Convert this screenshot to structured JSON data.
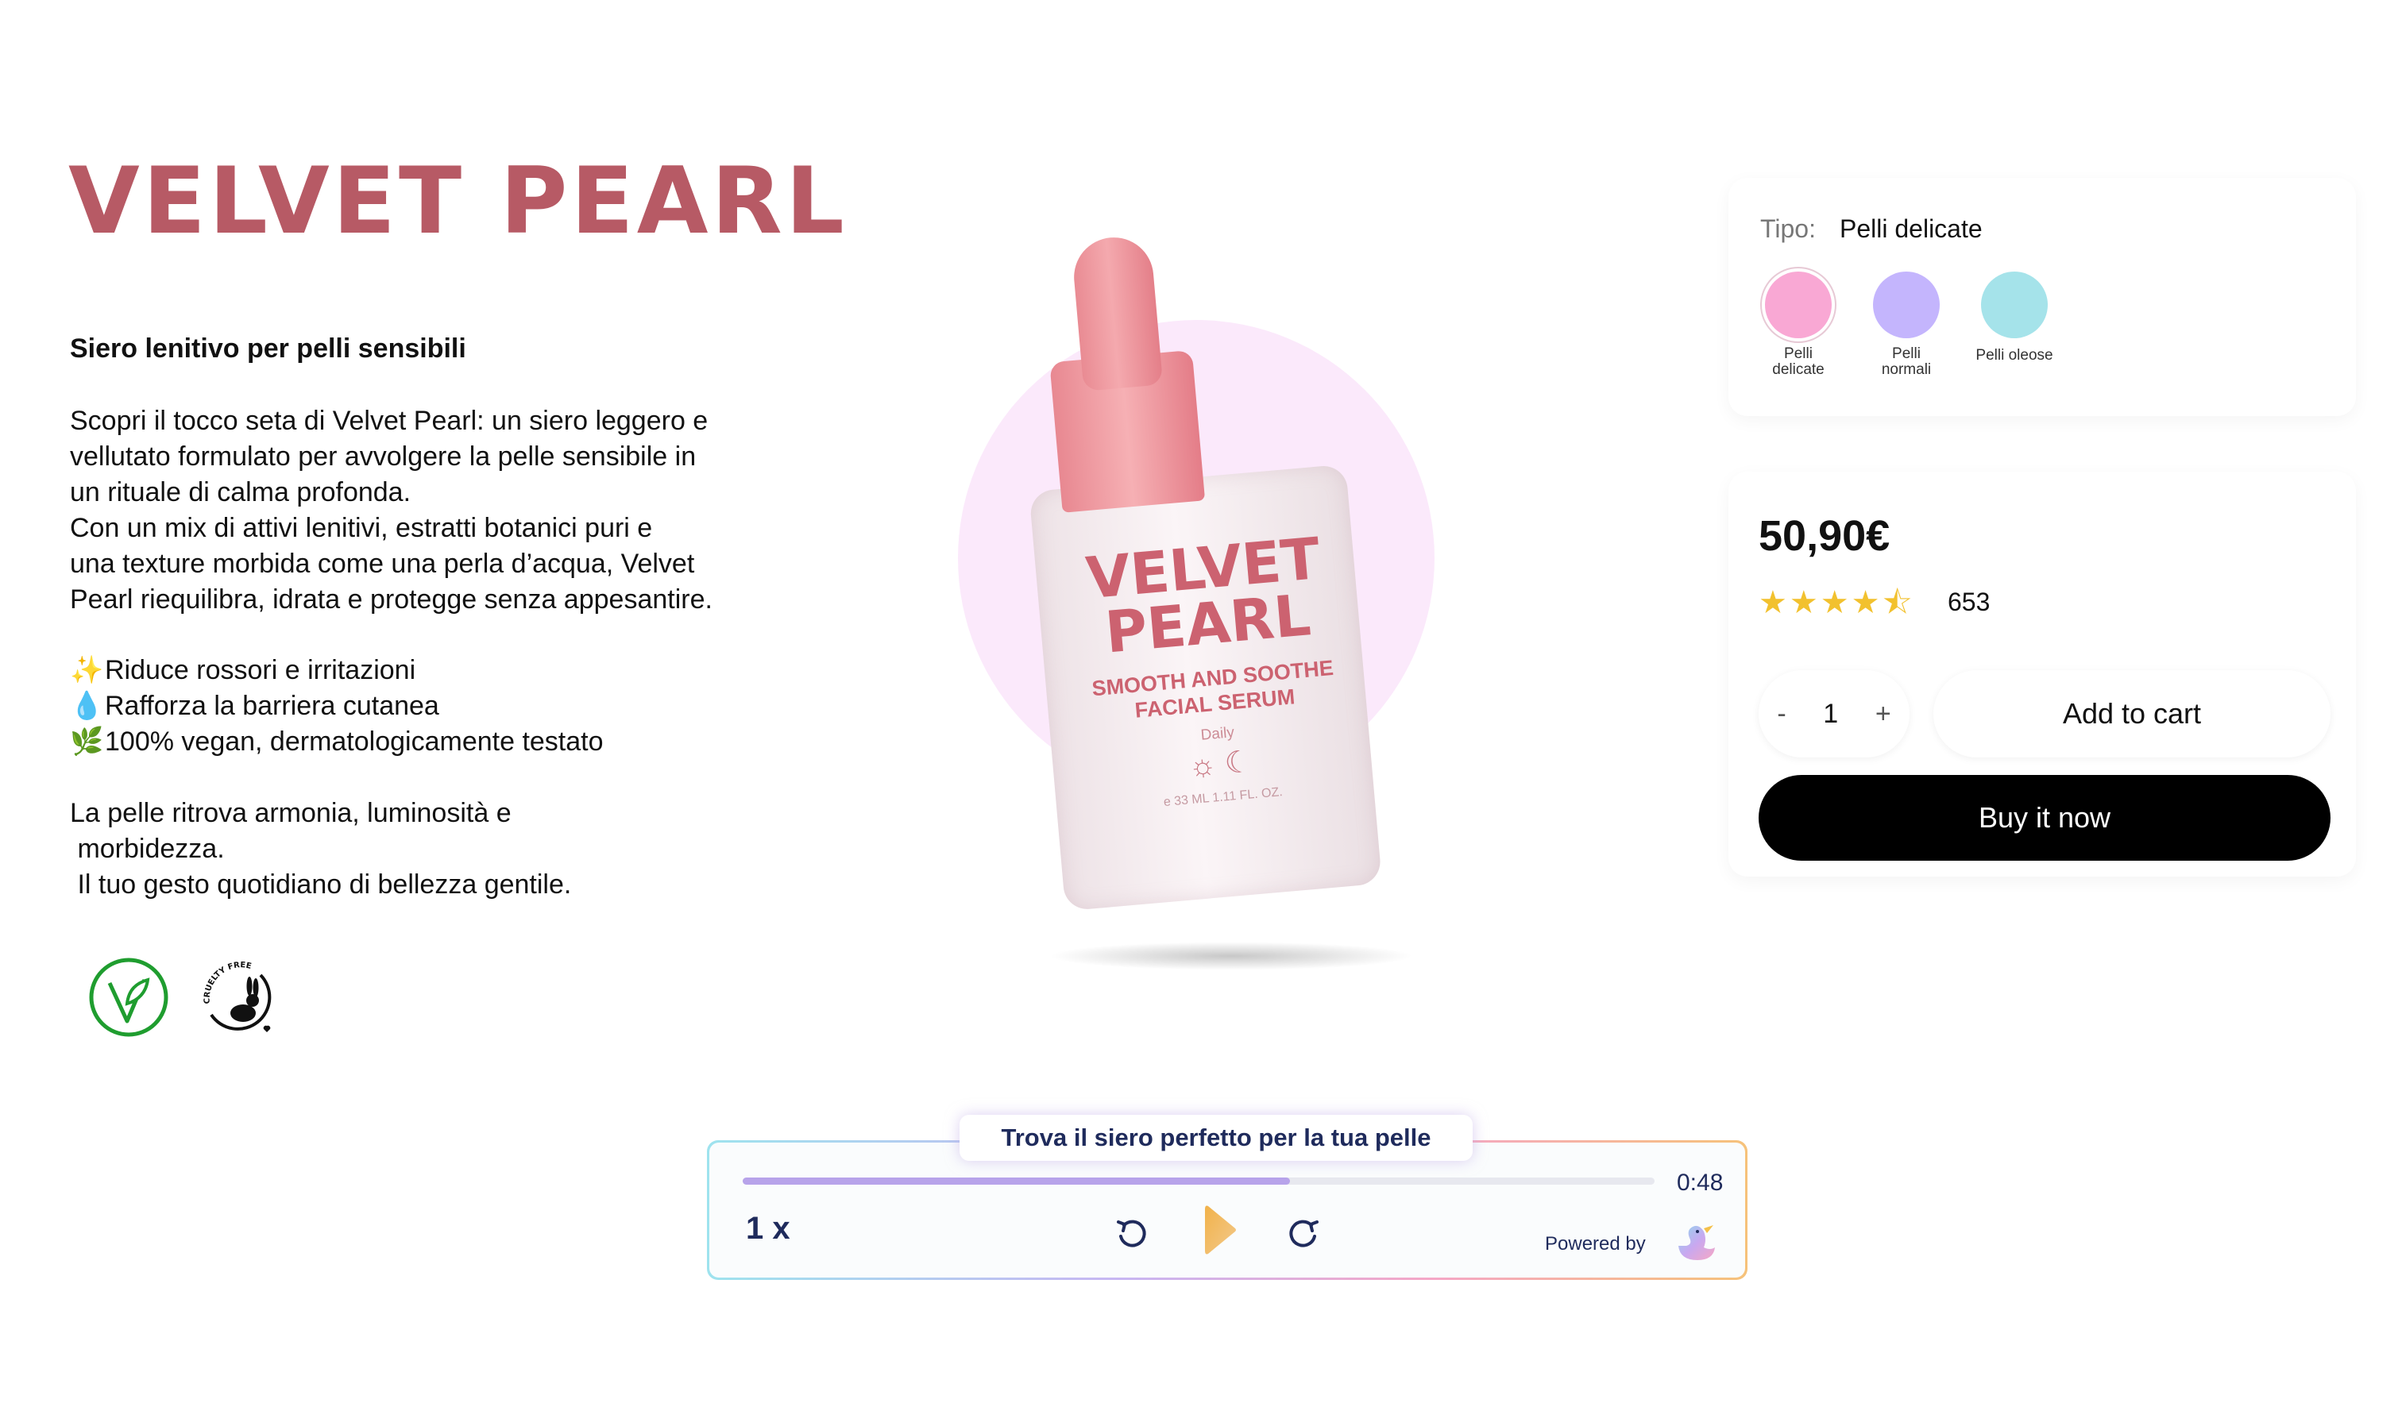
{
  "product": {
    "title": "VELVET PEARL",
    "subtitle": "Siero lenitivo per pelli sensibili",
    "intro": [
      "Scopri il tocco seta di Velvet Pearl: un siero leggero e",
      "vellutato formulato per avvolgere la pelle sensibile in",
      "un rituale di calma profonda.",
      "Con un mix di attivi lenitivi, estratti botanici puri e",
      "una texture morbida come una perla d’acqua, Velvet",
      "Pearl riequilibra, idrata e protegge senza appesantire."
    ],
    "bullets": [
      {
        "icon": "sparkles-icon",
        "glyph": "✨",
        "text": "Riduce rossori e irritazioni"
      },
      {
        "icon": "droplet-icon",
        "glyph": "💧",
        "text": "Rafforza la barriera cutanea"
      },
      {
        "icon": "leaf-icon",
        "glyph": "🌿",
        "text": "100% vegan, dermatologicamente testato"
      }
    ],
    "closing": [
      "La pelle ritrova armonia, luminosità e",
      " morbidezza.",
      " Il tuo gesto quotidiano di bellezza gentile."
    ],
    "badges": {
      "vegan_icon": "vegan-v-leaf-icon",
      "cruelty_free_icon": "cruelty-free-rabbit-icon",
      "cruelty_free_text": "CRUELTY FREE"
    },
    "bottle_label": {
      "line1": "VELVET",
      "line2": "PEARL",
      "sub1": "SMOOTH AND SOOTHE",
      "sub2": "FACIAL SERUM",
      "daily": "Daily",
      "icons": "☼ ☾",
      "volume": "e 33 ML 1.11 FL. OZ."
    }
  },
  "variants": {
    "label": "Tipo:",
    "selected": "Pelli delicate",
    "options": [
      {
        "label_line1": "Pelli",
        "label_line2": "delicate",
        "color": "#f9a8d4"
      },
      {
        "label_line1": "Pelli",
        "label_line2": "normali",
        "color": "#c4b5fd"
      },
      {
        "label_line1": "Pelli oleose",
        "label_line2": "",
        "color": "#a5e3ea"
      }
    ]
  },
  "purchase": {
    "price": "50,90€",
    "stars": "★★★★⯪",
    "rating": 4.5,
    "review_count": "653",
    "qty_minus": "-",
    "qty_value": "1",
    "qty_plus": "+",
    "add_to_cart": "Add to cart",
    "buy_now": "Buy it now"
  },
  "player": {
    "title": "Trova il siero perfetto per la tua pelle",
    "progress": 0.6,
    "time": "0:48",
    "speed": "1 x",
    "powered_by": "Powered by",
    "icons": [
      "rewind-icon",
      "play-icon",
      "forward-icon",
      "duck-logo-icon"
    ]
  },
  "colors": {
    "brand": "#b75a65",
    "player_text": "#1f2b5c",
    "progress_fill": "#b7a3ea",
    "halo": "#fbe9fb"
  }
}
